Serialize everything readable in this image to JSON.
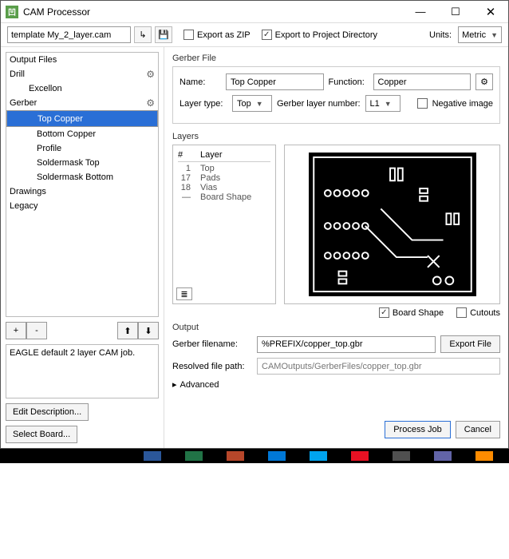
{
  "window": {
    "title": "CAM Processor",
    "icon_char": "凹"
  },
  "toolbar": {
    "template_value": "template My_2_layer.cam",
    "export_zip_label": "Export as ZIP",
    "export_zip_checked": false,
    "export_proj_label": "Export to Project Directory",
    "export_proj_checked": true,
    "units_label": "Units:",
    "units_value": "Metric"
  },
  "tree": {
    "heading": "Output Files",
    "items": [
      {
        "label": "Drill",
        "depth": 0,
        "gear": true
      },
      {
        "label": "Excellon",
        "depth": 1
      },
      {
        "label": "Gerber",
        "depth": 0,
        "gear": true
      },
      {
        "label": "Top Copper",
        "depth": 2,
        "selected": true
      },
      {
        "label": "Bottom Copper",
        "depth": 2
      },
      {
        "label": "Profile",
        "depth": 2
      },
      {
        "label": "Soldermask Top",
        "depth": 2
      },
      {
        "label": "Soldermask Bottom",
        "depth": 2
      },
      {
        "label": "Drawings",
        "depth": 0
      },
      {
        "label": "Legacy",
        "depth": 0
      }
    ],
    "btn_add": "+",
    "btn_remove": "-",
    "btn_up": "⬆",
    "btn_down": "⬇"
  },
  "description": {
    "text": "EAGLE default 2 layer CAM job.",
    "edit_btn": "Edit Description...",
    "select_board_btn": "Select Board..."
  },
  "gerber": {
    "group_label": "Gerber File",
    "name_label": "Name:",
    "name_value": "Top Copper",
    "function_label": "Function:",
    "function_value": "Copper",
    "layer_type_label": "Layer type:",
    "layer_type_value": "Top",
    "layer_num_label": "Gerber layer number:",
    "layer_num_value": "L1",
    "neg_image_label": "Negative image",
    "neg_image_checked": false
  },
  "layers": {
    "group_label": "Layers",
    "col_num": "#",
    "col_layer": "Layer",
    "rows": [
      {
        "n": "1",
        "name": "Top"
      },
      {
        "n": "17",
        "name": "Pads"
      },
      {
        "n": "18",
        "name": "Vias"
      },
      {
        "n": "—",
        "name": "Board Shape"
      }
    ],
    "board_shape_label": "Board Shape",
    "board_shape_checked": true,
    "cutouts_label": "Cutouts",
    "cutouts_checked": false
  },
  "output": {
    "group_label": "Output",
    "gerber_filename_label": "Gerber filename:",
    "gerber_filename_value": "%PREFIX/copper_top.gbr",
    "export_file_btn": "Export File",
    "resolved_label": "Resolved file path:",
    "resolved_value": "CAMOutputs/GerberFiles/copper_top.gbr",
    "advanced_label": "Advanced"
  },
  "footer": {
    "process": "Process Job",
    "cancel": "Cancel"
  }
}
